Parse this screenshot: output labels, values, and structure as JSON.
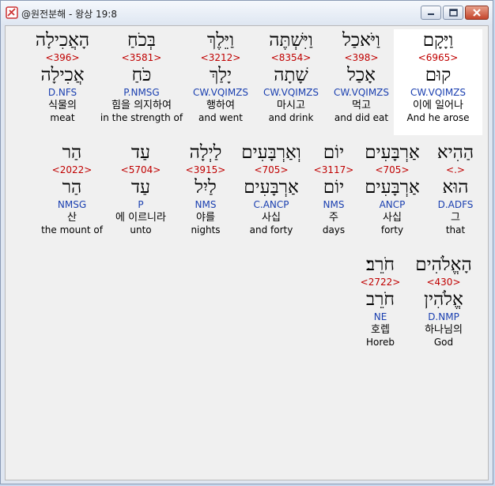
{
  "window": {
    "title": "@원전분해 - 왕상 19:8",
    "buttons": {
      "minimize": "minimize",
      "maximize": "maximize",
      "close": "close"
    }
  },
  "rows": [
    [
      {
        "heb": "וַיָּקָם",
        "strong": "<6965>",
        "lemma": "קוּם",
        "gram": "CW.VQIMZS",
        "kor": "이에 일어나",
        "eng": "And he arose",
        "selected": true
      },
      {
        "heb": "וַיֹּאכַל",
        "strong": "<398>",
        "lemma": "אָכַל",
        "gram": "CW.VQIMZS",
        "kor": "먹고",
        "eng": "and did eat"
      },
      {
        "heb": "וַיִּשְׁתֶּה",
        "strong": "<8354>",
        "lemma": "שָׁתָה",
        "gram": "CW.VQIMZS",
        "kor": "마시고",
        "eng": "and drink"
      },
      {
        "heb": "וַיֵּלֶךְ",
        "strong": "<3212>",
        "lemma": "יָלַךְ",
        "gram": "CW.VQIMZS",
        "kor": "행하여",
        "eng": "and went"
      },
      {
        "heb": "בְּכֹחַ",
        "strong": "<3581>",
        "lemma": "כֹּחַ",
        "gram": "P.NMSG",
        "kor": "힘을 의지하여",
        "eng": "in the strength of"
      },
      {
        "heb": "הָאֲכִילָה",
        "strong": "<396>",
        "lemma": "אֲכִילָה",
        "gram": "D.NFS",
        "kor": "식물의",
        "eng": "meat"
      }
    ],
    [
      {
        "heb": "הַהִיא",
        "strong": "<.>",
        "lemma": "הוּא",
        "gram": "D.ADFS",
        "kor": "그",
        "eng": "that"
      },
      {
        "heb": "אַרְבָּעִים",
        "strong": "<705>",
        "lemma": "אַרְבָּעִים",
        "gram": "ANCP",
        "kor": "사십",
        "eng": "forty"
      },
      {
        "heb": "יוֹם",
        "strong": "<3117>",
        "lemma": "יוֹם",
        "gram": "NMS",
        "kor": "주",
        "eng": "days"
      },
      {
        "heb": "וְאַרְבָּעִים",
        "strong": "<705>",
        "lemma": "אַרְבָּעִים",
        "gram": "C.ANCP",
        "kor": "사십",
        "eng": "and forty"
      },
      {
        "heb": "לַיְלָה",
        "strong": "<3915>",
        "lemma": "לַיִל",
        "gram": "NMS",
        "kor": "야를",
        "eng": "nights"
      },
      {
        "heb": "עַד",
        "strong": "<5704>",
        "lemma": "עַד",
        "gram": "P",
        "kor": "에 이르니라",
        "eng": "unto"
      },
      {
        "heb": "הַר",
        "strong": "<2022>",
        "lemma": "הַר",
        "gram": "NMSG",
        "kor": "산",
        "eng": "the mount of"
      }
    ],
    [
      {
        "heb": "הָאֱלֹהִים",
        "strong": "<430>",
        "lemma": "אֱלֹהִין",
        "gram": "D.NMP",
        "kor": "하나님의",
        "eng": "God"
      },
      {
        "heb": "חֹרֵב׃",
        "strong": "<2722>",
        "lemma": "חֹרֵב",
        "gram": "NE",
        "kor": "호렙",
        "eng": "Horeb"
      }
    ]
  ]
}
